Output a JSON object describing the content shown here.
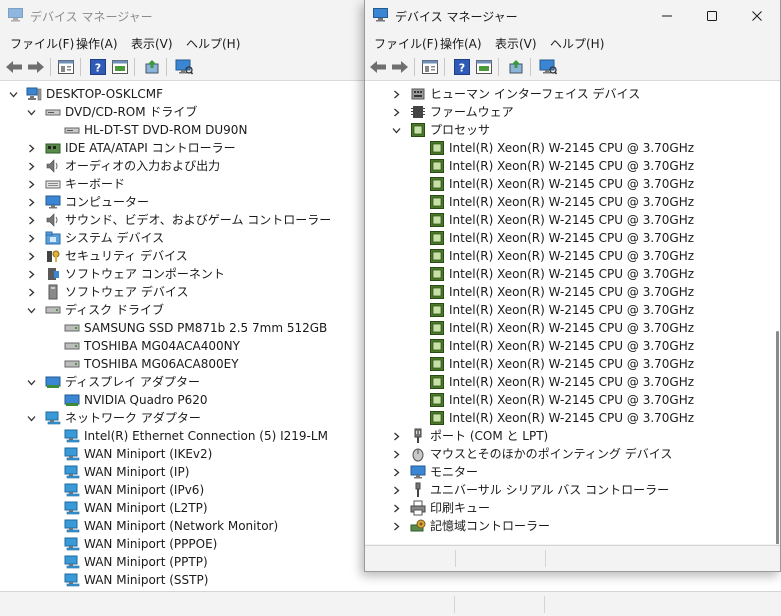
{
  "back_window": {
    "title": "デバイス マネージャー",
    "menu": [
      "ファイル(F)",
      "操作(A)",
      "表示(V)",
      "ヘルプ(H)"
    ],
    "root": "DESKTOP-OSKLCMF",
    "tree": [
      {
        "label": "DVD/CD-ROM ドライブ",
        "icon": "dvd-drive-icon",
        "level": 1,
        "state": "expanded"
      },
      {
        "label": "HL-DT-ST DVD-ROM DU90N",
        "icon": "dvd-drive-icon",
        "level": 2,
        "state": "leaf"
      },
      {
        "label": "IDE ATA/ATAPI コントローラー",
        "icon": "ide-controller-icon",
        "level": 1,
        "state": "collapsed"
      },
      {
        "label": "オーディオの入力および出力",
        "icon": "speaker-icon",
        "level": 1,
        "state": "collapsed"
      },
      {
        "label": "キーボード",
        "icon": "keyboard-icon",
        "level": 1,
        "state": "collapsed"
      },
      {
        "label": "コンピューター",
        "icon": "monitor-icon",
        "level": 1,
        "state": "collapsed"
      },
      {
        "label": "サウンド、ビデオ、およびゲーム コントローラー",
        "icon": "speaker-icon",
        "level": 1,
        "state": "collapsed"
      },
      {
        "label": "システム デバイス",
        "icon": "system-folder-icon",
        "level": 1,
        "state": "collapsed"
      },
      {
        "label": "セキュリティ デバイス",
        "icon": "security-key-icon",
        "level": 1,
        "state": "collapsed"
      },
      {
        "label": "ソフトウェア コンポーネント",
        "icon": "software-component-icon",
        "level": 1,
        "state": "collapsed"
      },
      {
        "label": "ソフトウェア デバイス",
        "icon": "software-device-icon",
        "level": 1,
        "state": "collapsed"
      },
      {
        "label": "ディスク ドライブ",
        "icon": "disk-drive-icon",
        "level": 1,
        "state": "expanded"
      },
      {
        "label": "SAMSUNG SSD PM871b 2.5 7mm 512GB",
        "icon": "disk-drive-icon",
        "level": 2,
        "state": "leaf"
      },
      {
        "label": "TOSHIBA MG04ACA400NY",
        "icon": "disk-drive-icon",
        "level": 2,
        "state": "leaf"
      },
      {
        "label": "TOSHIBA MG06ACA800EY",
        "icon": "disk-drive-icon",
        "level": 2,
        "state": "leaf"
      },
      {
        "label": "ディスプレイ アダプター",
        "icon": "display-adapter-icon",
        "level": 1,
        "state": "expanded"
      },
      {
        "label": "NVIDIA Quadro P620",
        "icon": "display-adapter-icon",
        "level": 2,
        "state": "leaf"
      },
      {
        "label": "ネットワーク アダプター",
        "icon": "network-adapter-icon",
        "level": 1,
        "state": "expanded"
      },
      {
        "label": "Intel(R) Ethernet Connection (5) I219-LM",
        "icon": "network-adapter-icon",
        "level": 2,
        "state": "leaf"
      },
      {
        "label": "WAN Miniport (IKEv2)",
        "icon": "network-adapter-icon",
        "level": 2,
        "state": "leaf"
      },
      {
        "label": "WAN Miniport (IP)",
        "icon": "network-adapter-icon",
        "level": 2,
        "state": "leaf"
      },
      {
        "label": "WAN Miniport (IPv6)",
        "icon": "network-adapter-icon",
        "level": 2,
        "state": "leaf"
      },
      {
        "label": "WAN Miniport (L2TP)",
        "icon": "network-adapter-icon",
        "level": 2,
        "state": "leaf"
      },
      {
        "label": "WAN Miniport (Network Monitor)",
        "icon": "network-adapter-icon",
        "level": 2,
        "state": "leaf"
      },
      {
        "label": "WAN Miniport (PPPOE)",
        "icon": "network-adapter-icon",
        "level": 2,
        "state": "leaf"
      },
      {
        "label": "WAN Miniport (PPTP)",
        "icon": "network-adapter-icon",
        "level": 2,
        "state": "leaf"
      },
      {
        "label": "WAN Miniport (SSTP)",
        "icon": "network-adapter-icon",
        "level": 2,
        "state": "leaf"
      }
    ]
  },
  "front_window": {
    "title": "デバイス マネージャー",
    "menu": [
      "ファイル(F)",
      "操作(A)",
      "表示(V)",
      "ヘルプ(H)"
    ],
    "tree": [
      {
        "label": "ヒューマン インターフェイス デバイス",
        "icon": "hid-icon",
        "level": 1,
        "state": "collapsed"
      },
      {
        "label": "ファームウェア",
        "icon": "firmware-icon",
        "level": 1,
        "state": "collapsed"
      },
      {
        "label": "プロセッサ",
        "icon": "processor-icon",
        "level": 1,
        "state": "expanded"
      },
      {
        "label": "Intel(R) Xeon(R) W-2145 CPU @ 3.70GHz",
        "icon": "processor-icon",
        "level": 2,
        "state": "leaf"
      },
      {
        "label": "Intel(R) Xeon(R) W-2145 CPU @ 3.70GHz",
        "icon": "processor-icon",
        "level": 2,
        "state": "leaf"
      },
      {
        "label": "Intel(R) Xeon(R) W-2145 CPU @ 3.70GHz",
        "icon": "processor-icon",
        "level": 2,
        "state": "leaf"
      },
      {
        "label": "Intel(R) Xeon(R) W-2145 CPU @ 3.70GHz",
        "icon": "processor-icon",
        "level": 2,
        "state": "leaf"
      },
      {
        "label": "Intel(R) Xeon(R) W-2145 CPU @ 3.70GHz",
        "icon": "processor-icon",
        "level": 2,
        "state": "leaf"
      },
      {
        "label": "Intel(R) Xeon(R) W-2145 CPU @ 3.70GHz",
        "icon": "processor-icon",
        "level": 2,
        "state": "leaf"
      },
      {
        "label": "Intel(R) Xeon(R) W-2145 CPU @ 3.70GHz",
        "icon": "processor-icon",
        "level": 2,
        "state": "leaf"
      },
      {
        "label": "Intel(R) Xeon(R) W-2145 CPU @ 3.70GHz",
        "icon": "processor-icon",
        "level": 2,
        "state": "leaf"
      },
      {
        "label": "Intel(R) Xeon(R) W-2145 CPU @ 3.70GHz",
        "icon": "processor-icon",
        "level": 2,
        "state": "leaf"
      },
      {
        "label": "Intel(R) Xeon(R) W-2145 CPU @ 3.70GHz",
        "icon": "processor-icon",
        "level": 2,
        "state": "leaf"
      },
      {
        "label": "Intel(R) Xeon(R) W-2145 CPU @ 3.70GHz",
        "icon": "processor-icon",
        "level": 2,
        "state": "leaf"
      },
      {
        "label": "Intel(R) Xeon(R) W-2145 CPU @ 3.70GHz",
        "icon": "processor-icon",
        "level": 2,
        "state": "leaf"
      },
      {
        "label": "Intel(R) Xeon(R) W-2145 CPU @ 3.70GHz",
        "icon": "processor-icon",
        "level": 2,
        "state": "leaf"
      },
      {
        "label": "Intel(R) Xeon(R) W-2145 CPU @ 3.70GHz",
        "icon": "processor-icon",
        "level": 2,
        "state": "leaf"
      },
      {
        "label": "Intel(R) Xeon(R) W-2145 CPU @ 3.70GHz",
        "icon": "processor-icon",
        "level": 2,
        "state": "leaf"
      },
      {
        "label": "Intel(R) Xeon(R) W-2145 CPU @ 3.70GHz",
        "icon": "processor-icon",
        "level": 2,
        "state": "leaf"
      },
      {
        "label": "ポート (COM と LPT)",
        "icon": "port-icon",
        "level": 1,
        "state": "collapsed"
      },
      {
        "label": "マウスとそのほかのポインティング デバイス",
        "icon": "mouse-icon",
        "level": 1,
        "state": "collapsed"
      },
      {
        "label": "モニター",
        "icon": "monitor-icon",
        "level": 1,
        "state": "collapsed"
      },
      {
        "label": "ユニバーサル シリアル バス コントローラー",
        "icon": "usb-icon",
        "level": 1,
        "state": "collapsed"
      },
      {
        "label": "印刷キュー",
        "icon": "printer-icon",
        "level": 1,
        "state": "collapsed"
      },
      {
        "label": "記憶域コントローラー",
        "icon": "storage-controller-icon",
        "level": 1,
        "state": "collapsed"
      }
    ]
  },
  "toolbar_icons": [
    "back-arrow-icon",
    "forward-arrow-icon",
    "properties-icon",
    "help-icon",
    "view-icon",
    "update-driver-icon",
    "scan-hardware-icon"
  ],
  "caption_icons": [
    "minimize-icon",
    "maximize-icon",
    "close-icon"
  ],
  "colors": {
    "window_bg": "#f3f3f3",
    "pane_bg": "#ffffff",
    "processor_green": "#4a7a2a",
    "monitor_blue": "#3a86d4"
  }
}
